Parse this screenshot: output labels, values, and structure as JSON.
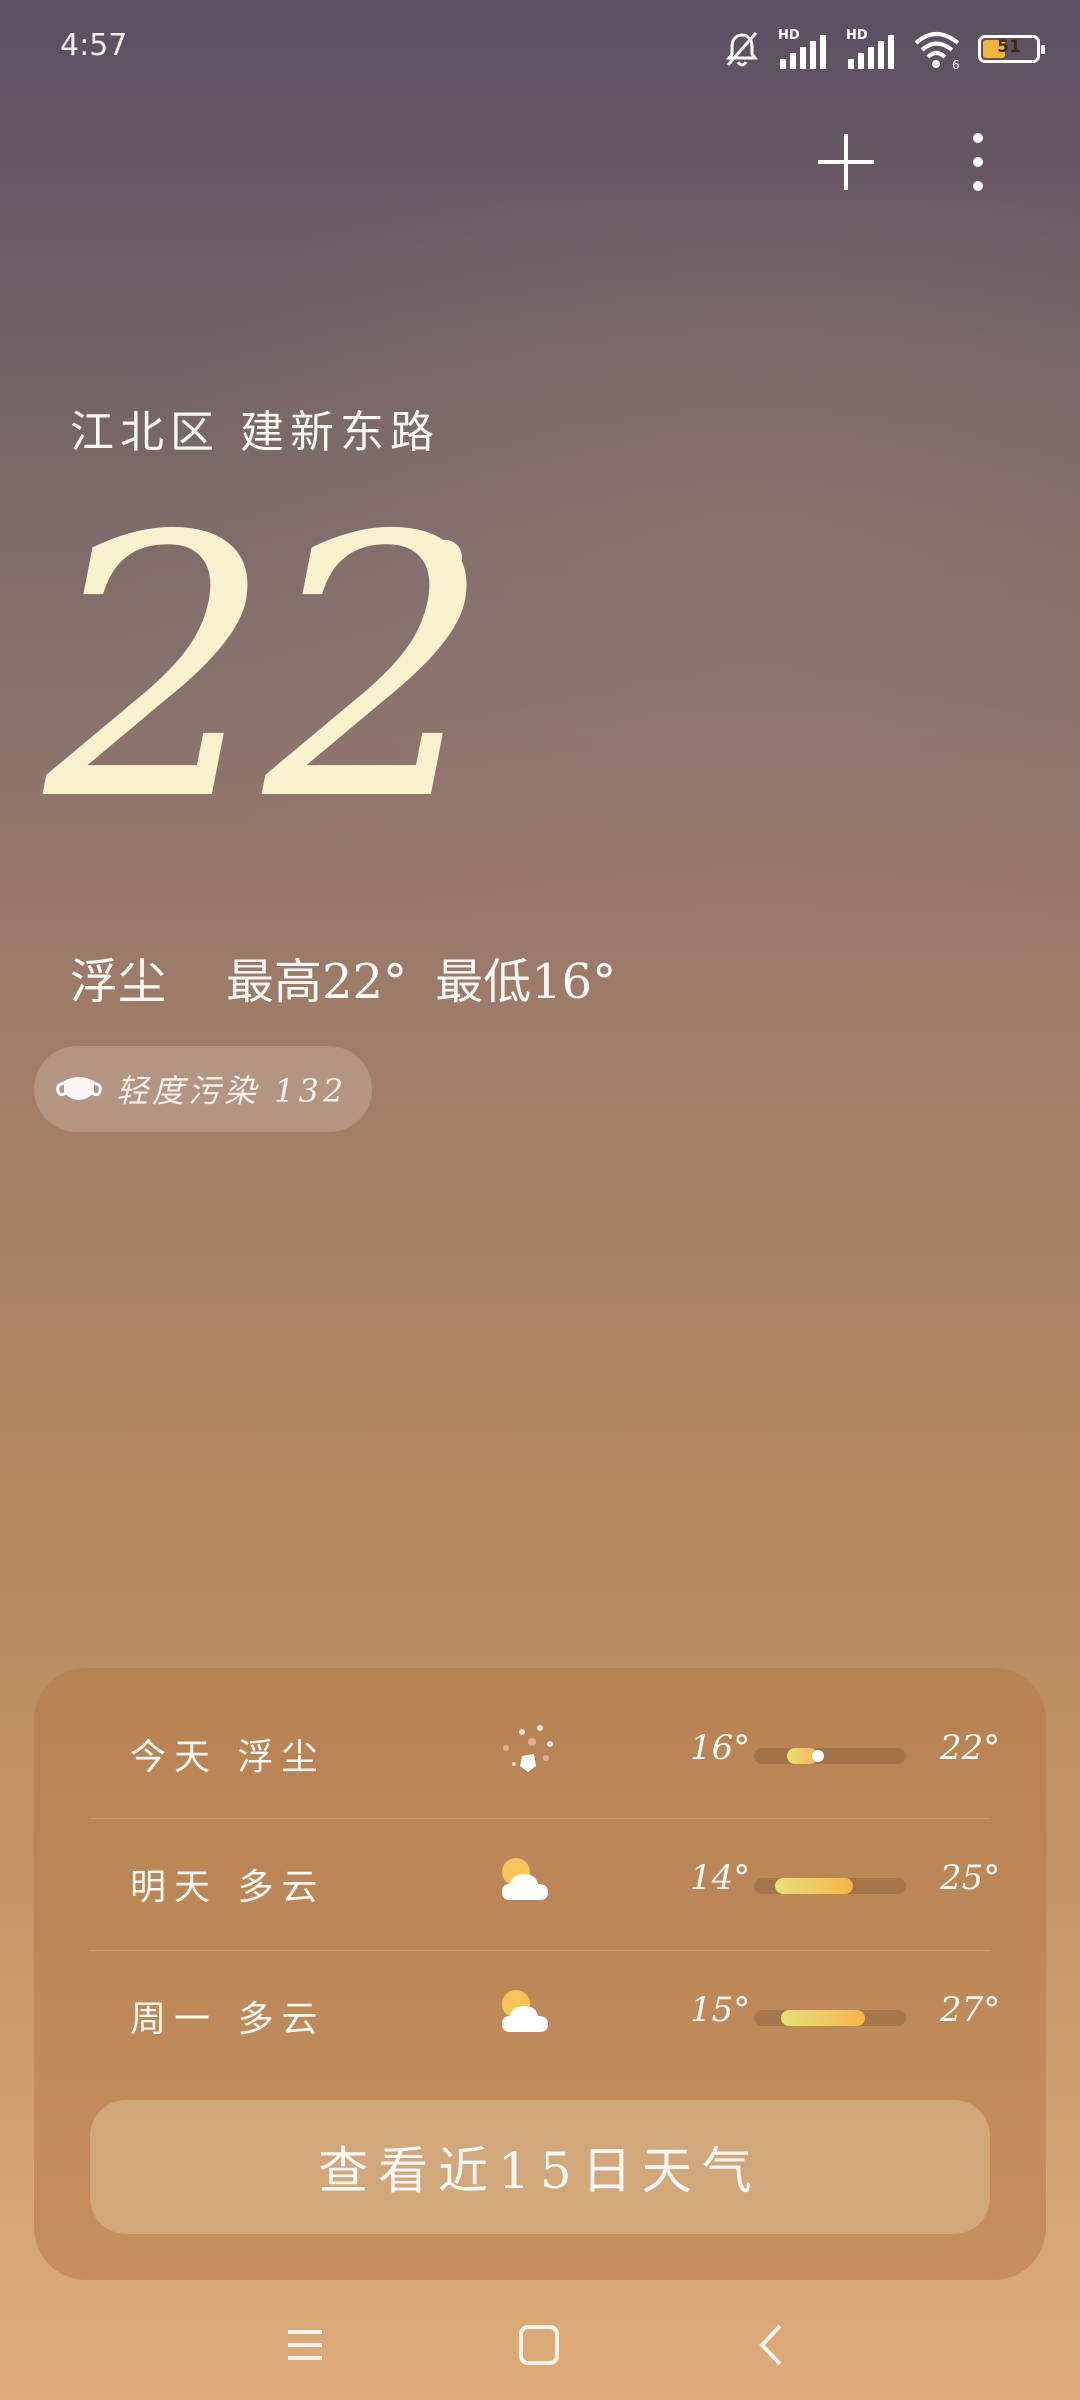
{
  "status_bar": {
    "time": "4:57",
    "battery_level": "51",
    "network_labels": [
      "HD",
      "HD"
    ],
    "wifi_label": "6"
  },
  "header": {
    "location": "江北区 建新东路"
  },
  "current": {
    "temperature": "22",
    "condition": "浮尘",
    "high_label": "最高22°",
    "low_label": "最低16°",
    "aqi_label": "轻度污染 132"
  },
  "forecast": [
    {
      "day": "今天 浮尘",
      "icon": "dust-icon",
      "low": "16°",
      "high": "22°",
      "bar_start": 0.22,
      "bar_end": 0.42,
      "current_point": 0.42
    },
    {
      "day": "明天 多云",
      "icon": "cloudy-icon",
      "low": "14°",
      "high": "25°",
      "bar_start": 0.14,
      "bar_end": 0.65
    },
    {
      "day": "周一 多云",
      "icon": "cloudy-icon",
      "low": "15°",
      "high": "27°",
      "bar_start": 0.18,
      "bar_end": 0.73
    }
  ],
  "forecast_button": "查看近15日天气",
  "colors": {
    "accent": "#f7b54a",
    "temperature_text": "#faf1cf"
  }
}
